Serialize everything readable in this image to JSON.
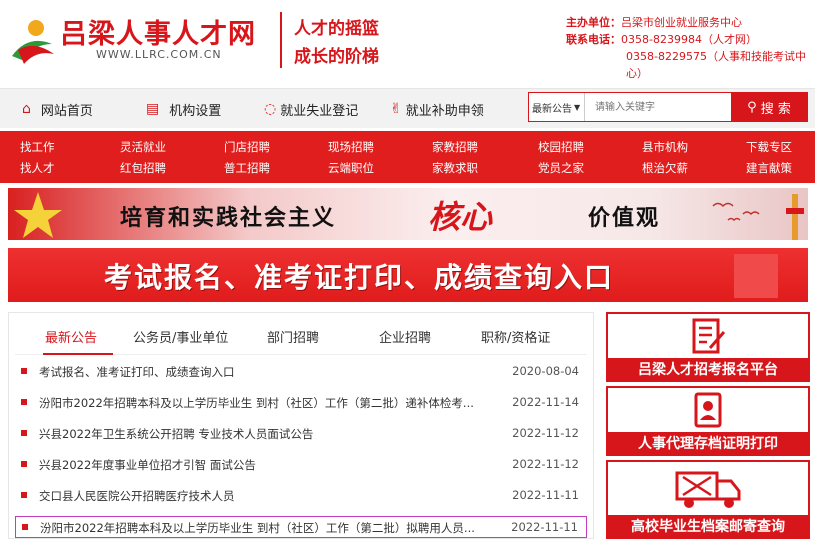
{
  "header": {
    "site_title": "吕梁人事人才网",
    "site_url": "WWW.LLRC.COM.CN",
    "slogan_line1": "人才的摇篮",
    "slogan_line2": "成长的阶梯",
    "host_label": "主办单位：",
    "host_value": "吕梁市创业就业服务中心",
    "phone_label": "联系电话：",
    "phone1": "0358-8239984（人才网）",
    "phone2": "0358-8229575（人事和技能考试中心）"
  },
  "nav": {
    "items": [
      {
        "label": "网站首页",
        "icon": "home-icon"
      },
      {
        "label": "机构设置",
        "icon": "document-icon"
      },
      {
        "label": "就业失业登记",
        "icon": "speech-icon"
      },
      {
        "label": "就业补助申领",
        "icon": "thumb-icon"
      }
    ]
  },
  "search": {
    "select_value": "最新公告",
    "placeholder": "请输入关键字",
    "button": "搜 索"
  },
  "menu": {
    "row1": [
      "找工作",
      "灵活就业",
      "门店招聘",
      "现场招聘",
      "家教招聘",
      "校园招聘",
      "县市机构",
      "下载专区"
    ],
    "row2": [
      "找人才",
      "红包招聘",
      "普工招聘",
      "云端职位",
      "家教求职",
      "党员之家",
      "根治欠薪",
      "建言献策"
    ]
  },
  "banner1": {
    "text_left": "培育和实践社会主义",
    "text_core": "核心",
    "text_right": "价值观"
  },
  "banner2": {
    "text": "考试报名、准考证打印、成绩查询入口"
  },
  "tabs": [
    "最新公告",
    "公务员/事业单位",
    "部门招聘",
    "企业招聘",
    "职称/资格证"
  ],
  "news": [
    {
      "title": "考试报名、准考证打印、成绩查询入口",
      "date": "2020-08-04"
    },
    {
      "title": "汾阳市2022年招聘本科及以上学历毕业生 到村（社区）工作（第二批）递补体检考...",
      "date": "2022-11-14"
    },
    {
      "title": "兴县2022年卫生系统公开招聘 专业技术人员面试公告",
      "date": "2022-11-12"
    },
    {
      "title": "兴县2022年度事业单位招才引智 面试公告",
      "date": "2022-11-12"
    },
    {
      "title": "交口县人民医院公开招聘医疗技术人员",
      "date": "2022-11-11"
    },
    {
      "title": "汾阳市2022年招聘本科及以上学历毕业生 到村（社区）工作（第二批）拟聘用人员...",
      "date": "2022-11-11"
    }
  ],
  "cards": [
    {
      "label": "吕梁人才招考报名平台",
      "icon": "edit-form-icon"
    },
    {
      "label": "人事代理存档证明打印",
      "icon": "id-card-icon"
    },
    {
      "label": "高校毕业生档案邮寄查询",
      "icon": "truck-icon"
    }
  ],
  "colors": {
    "brand_red": "#d7161b",
    "highlight": "#c23dbd"
  }
}
